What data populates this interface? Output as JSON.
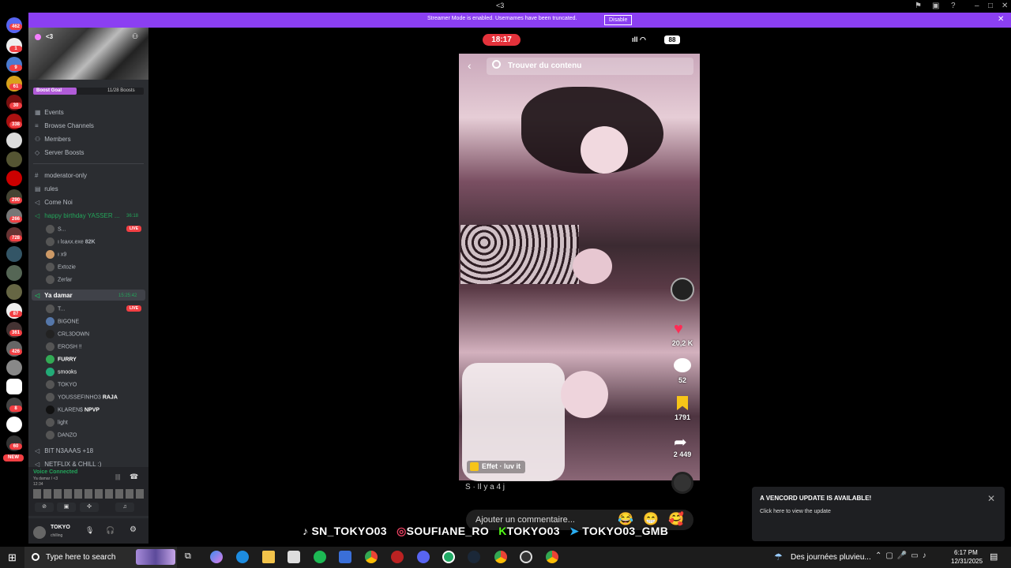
{
  "window": {
    "title": "<3"
  },
  "banner": {
    "message": "Streamer Mode is enabled. Usernames have been truncated.",
    "disable_label": "Disable",
    "close_icon": "close-icon"
  },
  "server_rail": {
    "badges": [
      "462",
      "1",
      "9",
      "61",
      "30",
      "338",
      "290",
      "266",
      "728",
      "87",
      "361",
      "426",
      "8",
      "60"
    ],
    "new_label": "NEW"
  },
  "sidebar": {
    "server_name": "<3",
    "boost": {
      "label": "Boost Goal",
      "count": "11/28 Boosts",
      "progress": 0.39
    },
    "nav": [
      {
        "label": "Events",
        "icon": "calendar-icon"
      },
      {
        "label": "Browse Channels",
        "icon": "list-icon"
      },
      {
        "label": "Members",
        "icon": "members-icon"
      },
      {
        "label": "Server Boosts",
        "icon": "boost-icon"
      }
    ],
    "channels": [
      {
        "label": "moderator-only",
        "icon": "hash-icon"
      },
      {
        "label": "rules",
        "icon": "rules-icon"
      },
      {
        "label": "Come Noi",
        "icon": "voice-icon"
      }
    ],
    "voice_channel_1": {
      "label": "happy birthday YASSER ...",
      "timer": "36:18",
      "users": [
        "S...",
        "ı lɛaʌx.exe",
        "ı x9",
        "Extozie",
        "Zerlar"
      ],
      "user_extra": "82K",
      "live_label": "LIVE"
    },
    "voice_channel_2": {
      "label": "Ya damar",
      "timer": "15:25:42",
      "users": [
        "T...",
        "BIGONE",
        "CRL3DOWN",
        "EROSH !!",
        "FURRY",
        "smooks",
        "TOKYO",
        "YOUSSEFINHO3",
        "KLAREN$",
        "light",
        "DANZO"
      ],
      "user_extra_raja": "RAJA",
      "user_extra_npvp": "NPVP",
      "live_label": "LIVE"
    },
    "more_channels": [
      "BIT N3AAAS +18",
      "NETFLIX & CHILL :)"
    ],
    "voice_panel": {
      "status": "Voice Connected",
      "subtitle": "Ya damar / <3",
      "time": "12:34"
    },
    "user": {
      "name": "TOKYO",
      "status": "chilling"
    }
  },
  "stream": {
    "status_time": "18:17",
    "battery": "88",
    "search_placeholder": "Trouver du contenu",
    "likes": "20,2 K",
    "comments": "52",
    "saves": "1791",
    "shares": "2 449",
    "effect_label": "Effet · luv it",
    "caption": "S · Il y a 4 j",
    "comment_placeholder": "Ajouter un commentaire...",
    "emojis": [
      "😂",
      "😁",
      "🥰"
    ],
    "socials": [
      {
        "label": "SN_TOKYO03",
        "icon": "tiktok-icon"
      },
      {
        "label": "SOUFIANE_RO",
        "icon": "instagram-icon"
      },
      {
        "label": "TOKYO03",
        "icon": "kick-icon"
      },
      {
        "label": "TOKYO03_GMB",
        "icon": "telegram-icon"
      }
    ]
  },
  "toast": {
    "title": "A VENCORD UPDATE IS AVAILABLE!",
    "body": "Click here to view the update"
  },
  "taskbar": {
    "search_placeholder": "Type here to search",
    "weather": "Des journées pluvieu...",
    "time": "6:17 PM",
    "date": "12/31/2025"
  }
}
